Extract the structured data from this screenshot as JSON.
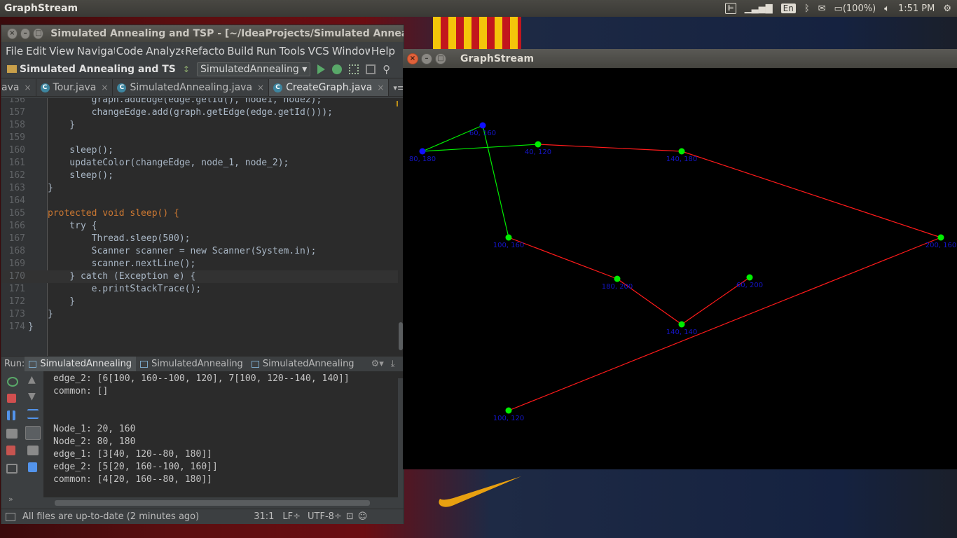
{
  "top_panel": {
    "title": "GraphStream",
    "keyboard": "En",
    "battery": "(100%)",
    "clock": "1:51 PM"
  },
  "ide": {
    "window_title": "Simulated Annealing and TSP - [~/IdeaProjects/Simulated Annealing a",
    "menu": [
      "File",
      "Edit",
      "View",
      "Navigate",
      "Code",
      "Analyze",
      "Refactor",
      "Build",
      "Run",
      "Tools",
      "VCS",
      "Window",
      "Help"
    ],
    "project": "Simulated Annealing and TS",
    "run_config": "SimulatedAnnealing",
    "tabs": [
      {
        "label": "ava",
        "icon": ""
      },
      {
        "label": "Tour.java",
        "icon": "C"
      },
      {
        "label": "SimulatedAnnealing.java",
        "icon": "C"
      },
      {
        "label": "CreateGraph.java",
        "icon": "C"
      }
    ],
    "tabs_more": "▾≡",
    "code": [
      {
        "n": "156",
        "t": "        graph.addEdge(edge.getId(), node1, node2);"
      },
      {
        "n": "157",
        "t": "        changeEdge.add(graph.getEdge(edge.getId()));"
      },
      {
        "n": "158",
        "t": "    }"
      },
      {
        "n": "159",
        "t": ""
      },
      {
        "n": "160",
        "t": "    sleep();"
      },
      {
        "n": "161",
        "t": "    updateColor(changeEdge, node_1, node_2);"
      },
      {
        "n": "162",
        "t": "    sleep();"
      },
      {
        "n": "163",
        "t": "}"
      },
      {
        "n": "164",
        "t": ""
      },
      {
        "n": "165",
        "t": "protected void sleep() {"
      },
      {
        "n": "166",
        "t": "    try {"
      },
      {
        "n": "167",
        "t": "        Thread.sleep(500);"
      },
      {
        "n": "168",
        "t": "        Scanner scanner = new Scanner(System.in);"
      },
      {
        "n": "169",
        "t": "        scanner.nextLine();"
      },
      {
        "n": "170",
        "t": "    } catch (Exception e) {"
      },
      {
        "n": "171",
        "t": "        e.printStackTrace();"
      },
      {
        "n": "172",
        "t": "    }"
      },
      {
        "n": "173",
        "t": "}"
      },
      {
        "n": "174",
        "t": "}"
      }
    ],
    "run_label": "Run:",
    "run_tabs": [
      "SimulatedAnnealing",
      "SimulatedAnnealing",
      "SimulatedAnnealing"
    ],
    "console": [
      "edge_2: [6[100, 160--100, 120], 7[100, 120--140, 140]]",
      "common: []",
      "",
      "",
      "Node_1: 20, 160",
      "Node_2: 80, 180",
      "edge_1: [3[40, 120--80, 180]]",
      "edge_2: [5[20, 160--100, 160]]",
      "common: [4[20, 160--80, 180]]"
    ],
    "status": {
      "message": "All files are up-to-date (2 minutes ago)",
      "position": "31:1",
      "line_sep": "LF÷",
      "encoding": "UTF-8÷"
    }
  },
  "graph_window": {
    "title": "GraphStream",
    "colors": {
      "green": "#00ee00",
      "red": "#ff1a1a",
      "blue_node": "#1010ff",
      "label": "#1515c8"
    },
    "nodes": [
      {
        "id": "a",
        "label": "80, 180",
        "color": "blue"
      },
      {
        "id": "b",
        "label": "60, 160",
        "color": "blue"
      },
      {
        "id": "c",
        "label": "40, 120",
        "color": "green"
      },
      {
        "id": "d",
        "label": "140, 180",
        "color": "green"
      },
      {
        "id": "e",
        "label": "200, 160",
        "color": "green"
      },
      {
        "id": "f",
        "label": "100, 160",
        "color": "green"
      },
      {
        "id": "g",
        "label": "180, 200",
        "color": "green"
      },
      {
        "id": "h",
        "label": "60, 200",
        "color": "green"
      },
      {
        "id": "i",
        "label": "140, 140",
        "color": "green"
      },
      {
        "id": "j",
        "label": "100, 120",
        "color": "green"
      }
    ],
    "edges": [
      {
        "from": "a",
        "to": "b",
        "color": "green"
      },
      {
        "from": "a",
        "to": "c",
        "color": "green"
      },
      {
        "from": "b",
        "to": "f",
        "color": "green"
      },
      {
        "from": "c",
        "to": "d",
        "color": "red"
      },
      {
        "from": "d",
        "to": "e",
        "color": "red"
      },
      {
        "from": "f",
        "to": "g",
        "color": "red"
      },
      {
        "from": "g",
        "to": "i",
        "color": "red"
      },
      {
        "from": "h",
        "to": "i",
        "color": "red"
      },
      {
        "from": "e",
        "to": "j",
        "color": "red"
      }
    ]
  }
}
